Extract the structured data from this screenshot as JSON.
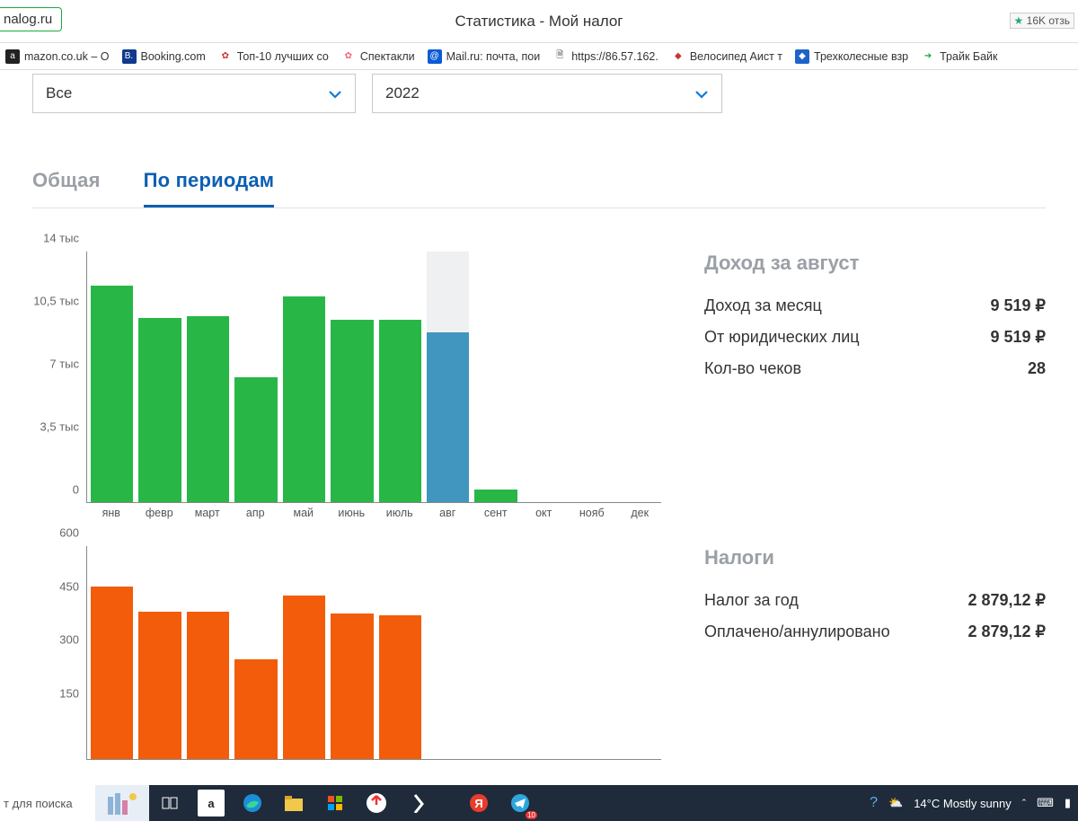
{
  "browser": {
    "url_fragment": "nalog.ru",
    "page_title": "Статистика - Мой налог",
    "reviews": "16K отзь",
    "bookmarks": [
      {
        "label": "mazon.co.uk – O",
        "icon": "a",
        "bg": "#222"
      },
      {
        "label": "Booking.com",
        "icon": "B.",
        "bg": "#103a8e"
      },
      {
        "label": "Топ-10 лучших со",
        "icon": "✿",
        "bg": "#fff",
        "fg": "#c33"
      },
      {
        "label": "Спектакли",
        "icon": "✿",
        "bg": "#fff",
        "fg": "#e67"
      },
      {
        "label": "Mail.ru: почта, пои",
        "icon": "@",
        "bg": "#0d5bd6"
      },
      {
        "label": "https://86.57.162.",
        "icon": "🗎",
        "bg": "#fff",
        "fg": "#555"
      },
      {
        "label": "Велосипед Аист т",
        "icon": "◆",
        "bg": "#fff",
        "fg": "#c33"
      },
      {
        "label": "Трехколесные взр",
        "icon": "◆",
        "bg": "#1e63c8"
      },
      {
        "label": "Трайк Байк",
        "icon": "➔",
        "bg": "#fff",
        "fg": "#1a3"
      }
    ]
  },
  "filters": {
    "type": "Все",
    "year": "2022"
  },
  "tabs": {
    "general": "Общая",
    "periods": "По периодам"
  },
  "income_panel": {
    "title": "Доход за август",
    "rows": [
      {
        "label": "Доход за месяц",
        "value": "9 519",
        "rub": true
      },
      {
        "label": "От юридических лиц",
        "value": "9 519",
        "rub": true
      },
      {
        "label": "Кол-во чеков",
        "value": "28",
        "rub": false
      }
    ]
  },
  "tax_panel": {
    "title": "Налоги",
    "rows": [
      {
        "label": "Налог за год",
        "value": "2 879,12",
        "rub": true
      },
      {
        "label": "Оплачено/аннулировано",
        "value": "2 879,12",
        "rub": true
      }
    ]
  },
  "taskbar": {
    "search_placeholder": "т для поиска",
    "weather": "14°C  Mostly sunny",
    "badge": "10"
  },
  "chart_data": [
    {
      "type": "bar",
      "title": "Доход по месяцам",
      "ylabel": "",
      "ylim": [
        0,
        14000
      ],
      "y_ticks": [
        "0",
        "3,5 тыс",
        "7 тыс",
        "10,5 тыс",
        "14 тыс"
      ],
      "categories": [
        "янв",
        "февр",
        "март",
        "апр",
        "май",
        "июнь",
        "июль",
        "авг",
        "сент",
        "окт",
        "нояб",
        "дек"
      ],
      "values": [
        12100,
        10300,
        10400,
        7000,
        11500,
        10200,
        10200,
        9500,
        700,
        0,
        0,
        0
      ],
      "selected_index": 7,
      "selected_bg_to_max": true,
      "color": "#28b746",
      "selected_color": "#4196bf"
    },
    {
      "type": "bar",
      "title": "Налог по месяцам",
      "ylabel": "",
      "ylim": [
        0,
        600
      ],
      "y_ticks": [
        "",
        "150",
        "300",
        "450",
        "600"
      ],
      "categories": [
        "янв",
        "февр",
        "март",
        "апр",
        "май",
        "июнь",
        "июль",
        "авг",
        "сент",
        "окт",
        "нояб",
        "дек"
      ],
      "values": [
        485,
        415,
        415,
        280,
        460,
        410,
        405,
        null,
        null,
        null,
        null,
        null
      ],
      "color": "#f25c0a"
    }
  ]
}
